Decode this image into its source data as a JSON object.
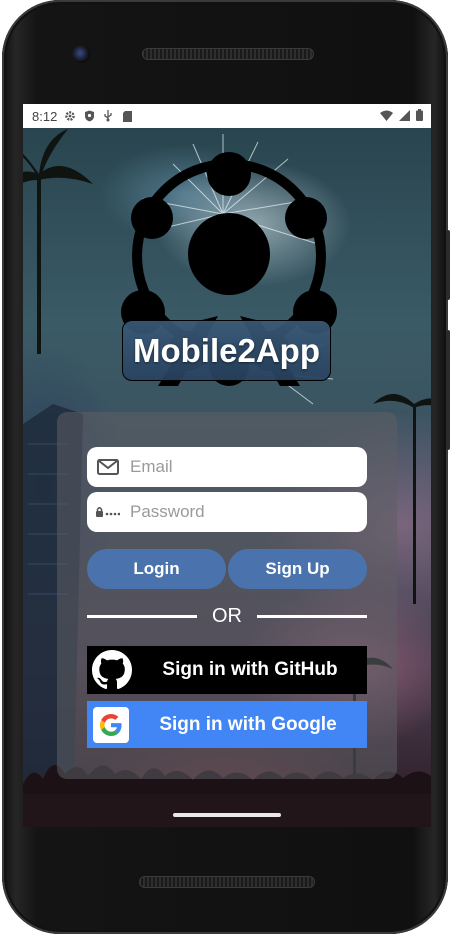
{
  "status_bar": {
    "time": "8:12",
    "left_icons": [
      "gear-icon",
      "shield-icon",
      "usb-debug-icon",
      "sd-card-icon"
    ],
    "right_icons": [
      "wifi-icon",
      "signal-icon",
      "battery-icon"
    ]
  },
  "app": {
    "brand_name": "Mobile2App",
    "logo_icon": "ferris-wheel-icon"
  },
  "login_form": {
    "email_placeholder": "Email",
    "password_placeholder": "Password",
    "email_value": "",
    "password_value": "",
    "email_icon": "envelope-icon",
    "password_icon": "lock-dots-icon",
    "login_label": "Login",
    "signup_label": "Sign Up",
    "separator_text": "OR",
    "github_label": "Sign in with GitHub",
    "github_icon": "github-icon",
    "google_label": "Sign in with Google",
    "google_icon": "google-icon"
  },
  "colors": {
    "pill_button": "#4a73ad",
    "github_button": "#000000",
    "google_button": "#4285f4",
    "brand_box": "#3a5a78"
  }
}
